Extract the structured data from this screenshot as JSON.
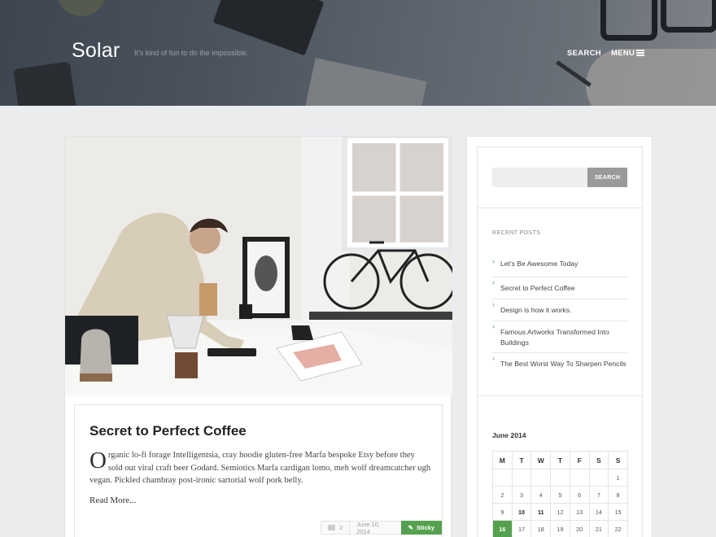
{
  "site": {
    "title": "Solar",
    "tagline": "It's kind of fun to do the impossible."
  },
  "nav": {
    "search_label": "SEARCH",
    "menu_label": "MENU"
  },
  "post": {
    "title": "Secret to Perfect Coffee",
    "dropcap": "O",
    "excerpt": "rganic lo-fi forage Intelligentsia, cray hoodie gluten-free Marfa bespoke Etsy before they sold out viral craft beer Godard. Semiotics Marfa cardigan lomo, meh wolf dreamcatcher ugh vegan. Pickled chambray post-ironic sartorial wolf pork belly.",
    "read_more": "Read More...",
    "comments": "2",
    "date": "June 10, 2014",
    "sticky": "Sticky"
  },
  "sidebar": {
    "search_button": "SEARCH",
    "recent_heading": "RECENT POSTS",
    "recent_posts": [
      "Let's Be Awesome Today",
      "Secret to Perfect Coffee",
      "Design is how it works.",
      "Famous Artworks Transformed Into Buildings",
      "The Best Worst Way To Sharpen Pencils"
    ],
    "calendar": {
      "title": "June 2014",
      "weekdays": [
        "M",
        "T",
        "W",
        "T",
        "F",
        "S",
        "S"
      ],
      "weeks": [
        [
          "",
          "",
          "",
          "",
          "",
          "",
          "1"
        ],
        [
          "2",
          "3",
          "4",
          "5",
          "6",
          "7",
          "8"
        ],
        [
          "9",
          "10",
          "11",
          "12",
          "13",
          "14",
          "15"
        ],
        [
          "16",
          "17",
          "18",
          "19",
          "20",
          "21",
          "22"
        ]
      ],
      "today": "16",
      "post_days": [
        "10",
        "11"
      ]
    }
  },
  "colors": {
    "accent": "#55a14f",
    "background": "#ebecee"
  }
}
